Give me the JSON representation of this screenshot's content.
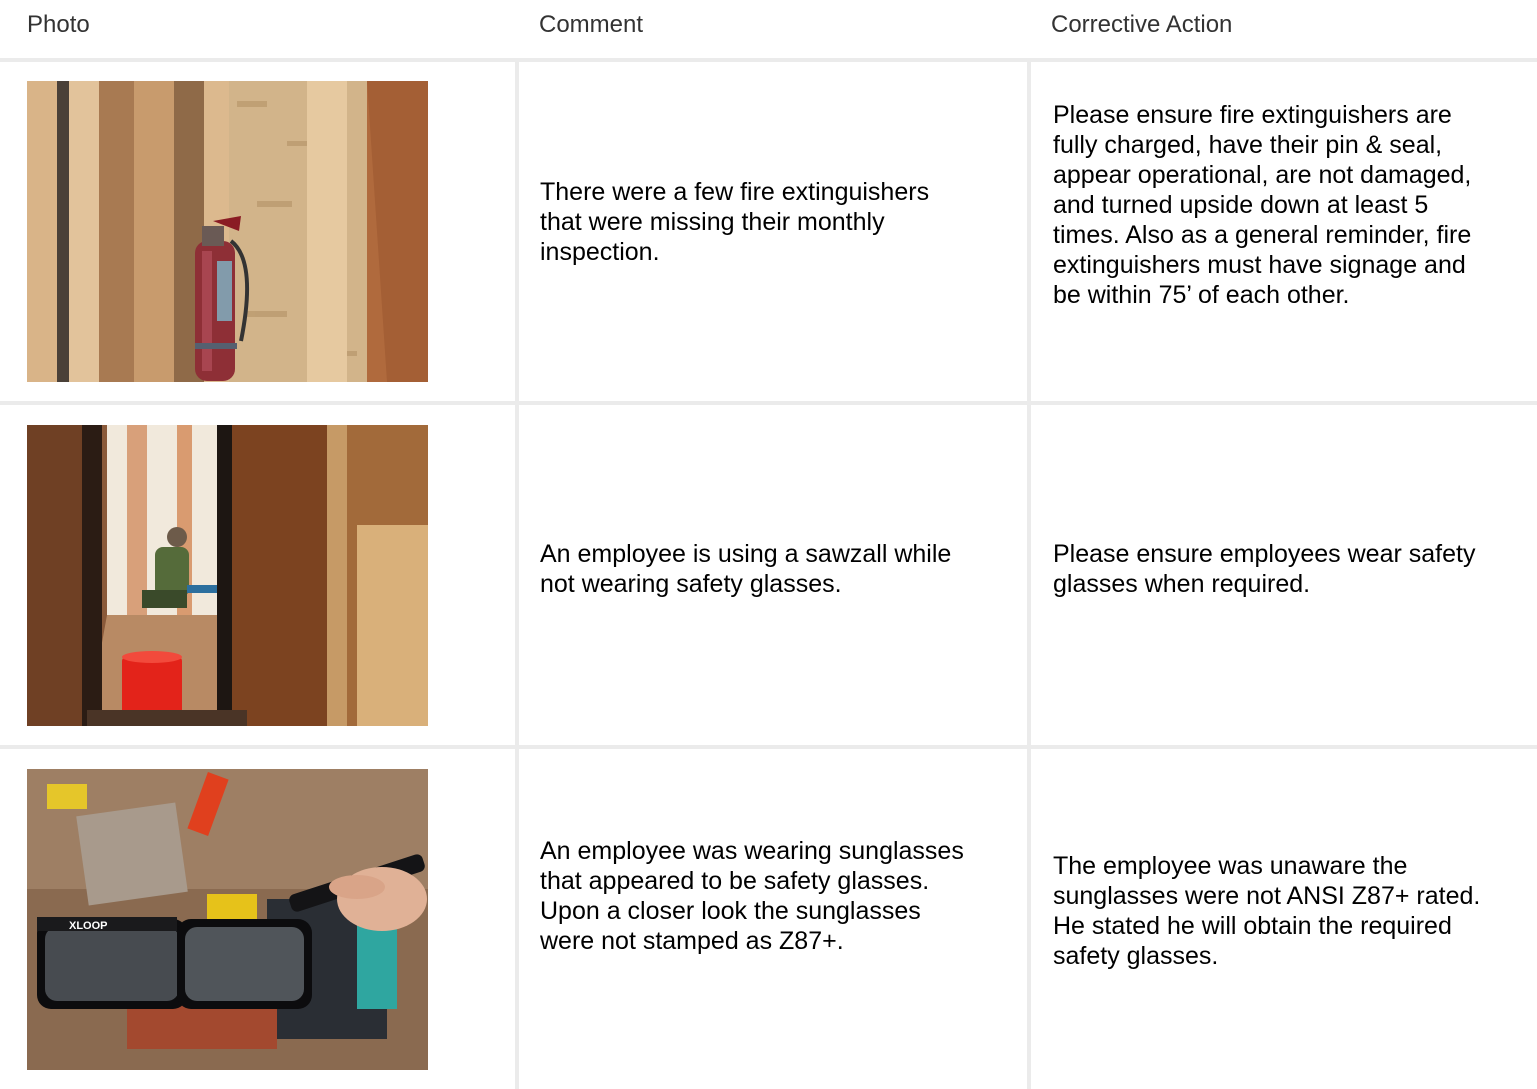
{
  "headers": {
    "photo": "Photo",
    "comment": "Comment",
    "action": "Corrective Action"
  },
  "rows": [
    {
      "photo_icon": "fire-extinguisher-photo",
      "comment": "There were a few fire extinguishers\nthat were missing their monthly\ninspection.",
      "action": "Please ensure fire extinguishers are\nfully charged, have their pin & seal,\nappear operational, are not damaged,\nand turned upside down at least 5\ntimes. Also as a general reminder, fire\nextinguishers must have signage and\nbe within 75’ of each other."
    },
    {
      "photo_icon": "employee-sawzall-photo",
      "comment": "An employee is using a sawzall while\nnot wearing safety glasses.",
      "action": "Please ensure employees wear safety\nglasses when required."
    },
    {
      "photo_icon": "sunglasses-photo",
      "photo_text": "XLOOP",
      "comment": "An employee was wearing sunglasses\nthat appeared to be safety glasses.\nUpon a closer look the sunglasses\nwere not stamped as Z87+.",
      "action": "The employee was unaware the\nsunglasses were not ANSI Z87+ rated.\nHe stated he will obtain the required\nsafety glasses."
    }
  ],
  "colors": {
    "grid": "#ebebeb",
    "header_text": "#333333",
    "body_text": "#000000"
  }
}
